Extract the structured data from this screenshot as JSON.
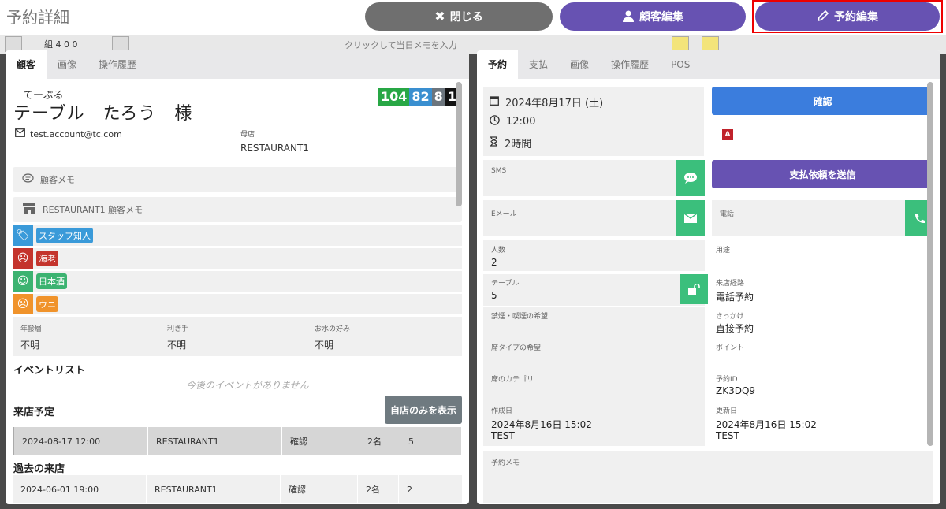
{
  "header": {
    "title": "予約詳細",
    "close_label": "閉じる",
    "customer_edit_label": "顧客編集",
    "reservation_edit_label": "予約編集"
  },
  "background": {
    "memo_placeholder": "クリックして当日メモを入力",
    "info": "組 4  0  0"
  },
  "left": {
    "tabs": [
      "顧客",
      "画像",
      "操作履歴"
    ],
    "kana": "てーぶる",
    "name": "テーブル　たろう　様",
    "badges": [
      "104",
      "82",
      "8",
      "1"
    ],
    "email": "test.account@tc.com",
    "shop_label": "母店",
    "shop_value": "RESTAURANT1",
    "customer_memo": "顧客メモ",
    "restaurant_memo": "RESTAURANT1 顧客メモ",
    "tags": [
      {
        "label": "スタッフ知人",
        "color": "#3a9ad9"
      },
      {
        "label": "海老",
        "color": "#c4342d"
      },
      {
        "label": "日本酒",
        "color": "#3cb371"
      },
      {
        "label": "ウニ",
        "color": "#f0932b"
      }
    ],
    "prefs": [
      {
        "label": "年齢層",
        "value": "不明"
      },
      {
        "label": "利き手",
        "value": "不明"
      },
      {
        "label": "お水の好み",
        "value": "不明"
      }
    ],
    "event_list_title": "イベントリスト",
    "no_events": "今後のイベントがありません",
    "upcoming_title": "来店予定",
    "own_only_button": "自店のみを表示",
    "upcoming": [
      {
        "datetime": "2024-08-17 12:00",
        "shop": "RESTAURANT1",
        "status": "確認",
        "people": "2名",
        "table": "5"
      }
    ],
    "past_title": "過去の来店",
    "past": [
      {
        "datetime": "2024-06-01 19:00",
        "shop": "RESTAURANT1",
        "status": "確認",
        "people": "2名",
        "table": "2"
      }
    ]
  },
  "right": {
    "tabs": [
      "予約",
      "支払",
      "画像",
      "操作履歴",
      "POS"
    ],
    "date": "2024年8月17日 (土)",
    "time": "12:00",
    "duration": "2時間",
    "confirm_label": "確認",
    "badge_letter": "A",
    "sms_label": "SMS",
    "payment_request_label": "支払依頼を送信",
    "email_label": "Eメール",
    "phone_label": "電話",
    "people_label": "人数",
    "people_value": "2",
    "purpose_label": "用途",
    "table_label": "テーブル",
    "table_value": "5",
    "route_label": "来店経路",
    "route_value": "電話予約",
    "smoking_label": "禁煙・喫煙の希望",
    "trigger_label": "きっかけ",
    "trigger_value": "直接予約",
    "seat_type_label": "席タイプの希望",
    "point_label": "ポイント",
    "seat_category_label": "席のカテゴリ",
    "reservation_id_label": "予約ID",
    "reservation_id_value": "ZK3DQ9",
    "created_label": "作成日",
    "created_value": "2024年8月16日 15:02",
    "created_by": "TEST",
    "updated_label": "更新日",
    "updated_value": "2024年8月16日 15:02",
    "updated_by": "TEST",
    "reservation_memo_label": "予約メモ"
  },
  "colors": {
    "purple": "#6752b2",
    "gray_button": "#6f6f6f",
    "confirm_blue": "#3b7ddd",
    "green": "#3bbf7c",
    "highlight_red": "#ee0000"
  }
}
